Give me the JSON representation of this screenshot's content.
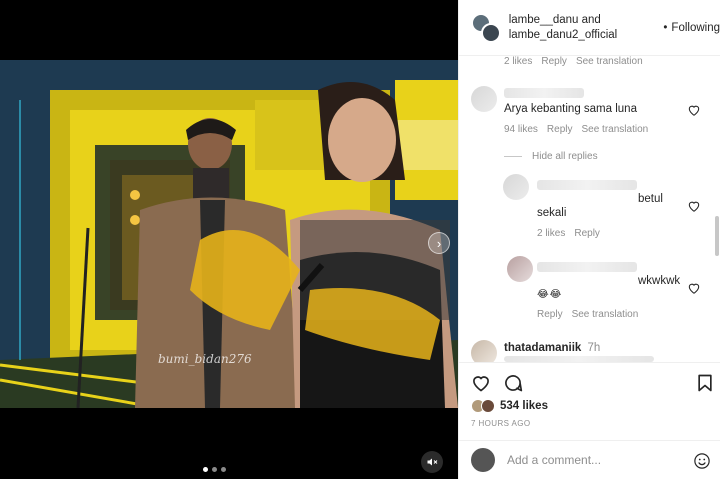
{
  "post": {
    "watermark": "bumi_bidan276"
  },
  "header": {
    "user1": "lambe__danu",
    "joiner": " and",
    "user2": "lambe_danu2_official",
    "following": "Following",
    "dot": "•"
  },
  "comments": {
    "top_meta": {
      "likes": "2 likes",
      "reply": "Reply",
      "translate": "See translation"
    },
    "items": [
      {
        "text": "Arya kebanting sama luna",
        "likes": "94 likes",
        "reply": "Reply",
        "translate": "See translation"
      }
    ],
    "hide_replies": "Hide all replies",
    "replies": [
      {
        "text_end": "betul",
        "text_line2": "sekali",
        "likes": "2 likes",
        "reply": "Reply"
      },
      {
        "text_end": "wkwkwk",
        "emoji": "😂😂",
        "reply": "Reply",
        "translate": "See translation"
      }
    ],
    "next_user": "thatadamaniik",
    "next_time": "7h"
  },
  "actions": {
    "likes_count": "534 likes",
    "timestamp": "7 HOURS AGO"
  },
  "composer": {
    "placeholder": "Add a comment..."
  },
  "icons": {
    "like": "heart-icon",
    "comment": "comment-icon",
    "save": "bookmark-icon",
    "emoji": "smiley-icon",
    "next": "chevron-right-icon",
    "mute": "speaker-muted-icon"
  },
  "colors": {
    "stage_yellow": "#e8d21a",
    "text": "#262626",
    "muted": "#8e8e8e"
  }
}
